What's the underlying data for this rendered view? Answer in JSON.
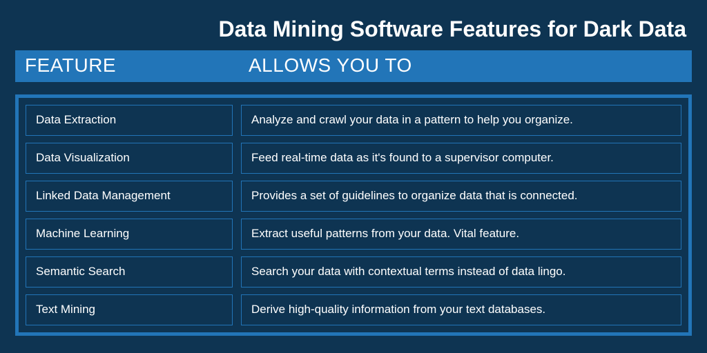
{
  "title": "Data Mining Software Features for Dark Data",
  "headers": {
    "feature": "FEATURE",
    "allows": "ALLOWS YOU TO"
  },
  "rows": [
    {
      "feature": "Data Extraction",
      "desc": "Analyze and crawl your data in a pattern to help you organize."
    },
    {
      "feature": "Data Visualization",
      "desc": "Feed real-time data as it's found to a supervisor computer."
    },
    {
      "feature": "Linked Data Management",
      "desc": "Provides a set of guidelines to organize data that is connected."
    },
    {
      "feature": "Machine Learning",
      "desc": "Extract useful patterns from your data. Vital feature."
    },
    {
      "feature": "Semantic Search",
      "desc": "Search your data with contextual terms instead of data lingo."
    },
    {
      "feature": "Text Mining",
      "desc": "Derive high-quality information from your text databases."
    }
  ]
}
